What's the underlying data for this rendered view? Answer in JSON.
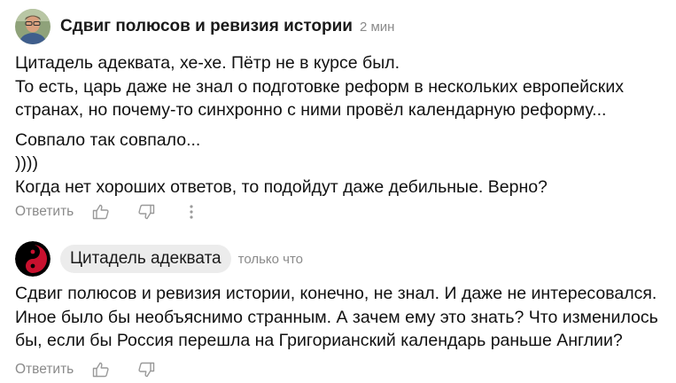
{
  "comments": [
    {
      "author": "Сдвиг полюсов и ревизия истории",
      "time": "2 мин",
      "lines": [
        "Цитадель адеквата, хе-хе. Пётр не в курсе был.",
        "То есть, царь даже не знал о подготовке реформ в нескольких европейских",
        "странах, но почему-то синхронно с ними провёл календарную реформу...",
        "Совпало так совпало...",
        "))))",
        "Когда нет хороших ответов, то подойдут даже дебильные. Верно?"
      ],
      "reply_label": "Ответить",
      "icons": [
        "thumbs-up-icon",
        "thumbs-down-icon",
        "more-vertical-icon"
      ]
    },
    {
      "author": "Цитадель адеквата",
      "time": "только что",
      "lines": [
        "Сдвиг полюсов и ревизия истории, конечно, не знал. И даже не интересовался.",
        "Иное было бы необъяснимо странным. А зачем ему это знать? Что изменилось",
        "бы, если бы Россия перешла на Григорианский календарь раньше Англии?"
      ],
      "reply_label": "Ответить",
      "icons": [
        "thumbs-up-icon",
        "thumbs-down-icon"
      ]
    }
  ],
  "colors": {
    "text": "#111111",
    "muted": "#8a8a8a",
    "pill_bg": "#ececec",
    "icon": "#9a9a9a",
    "yin_yang_red": "#c8102e"
  }
}
